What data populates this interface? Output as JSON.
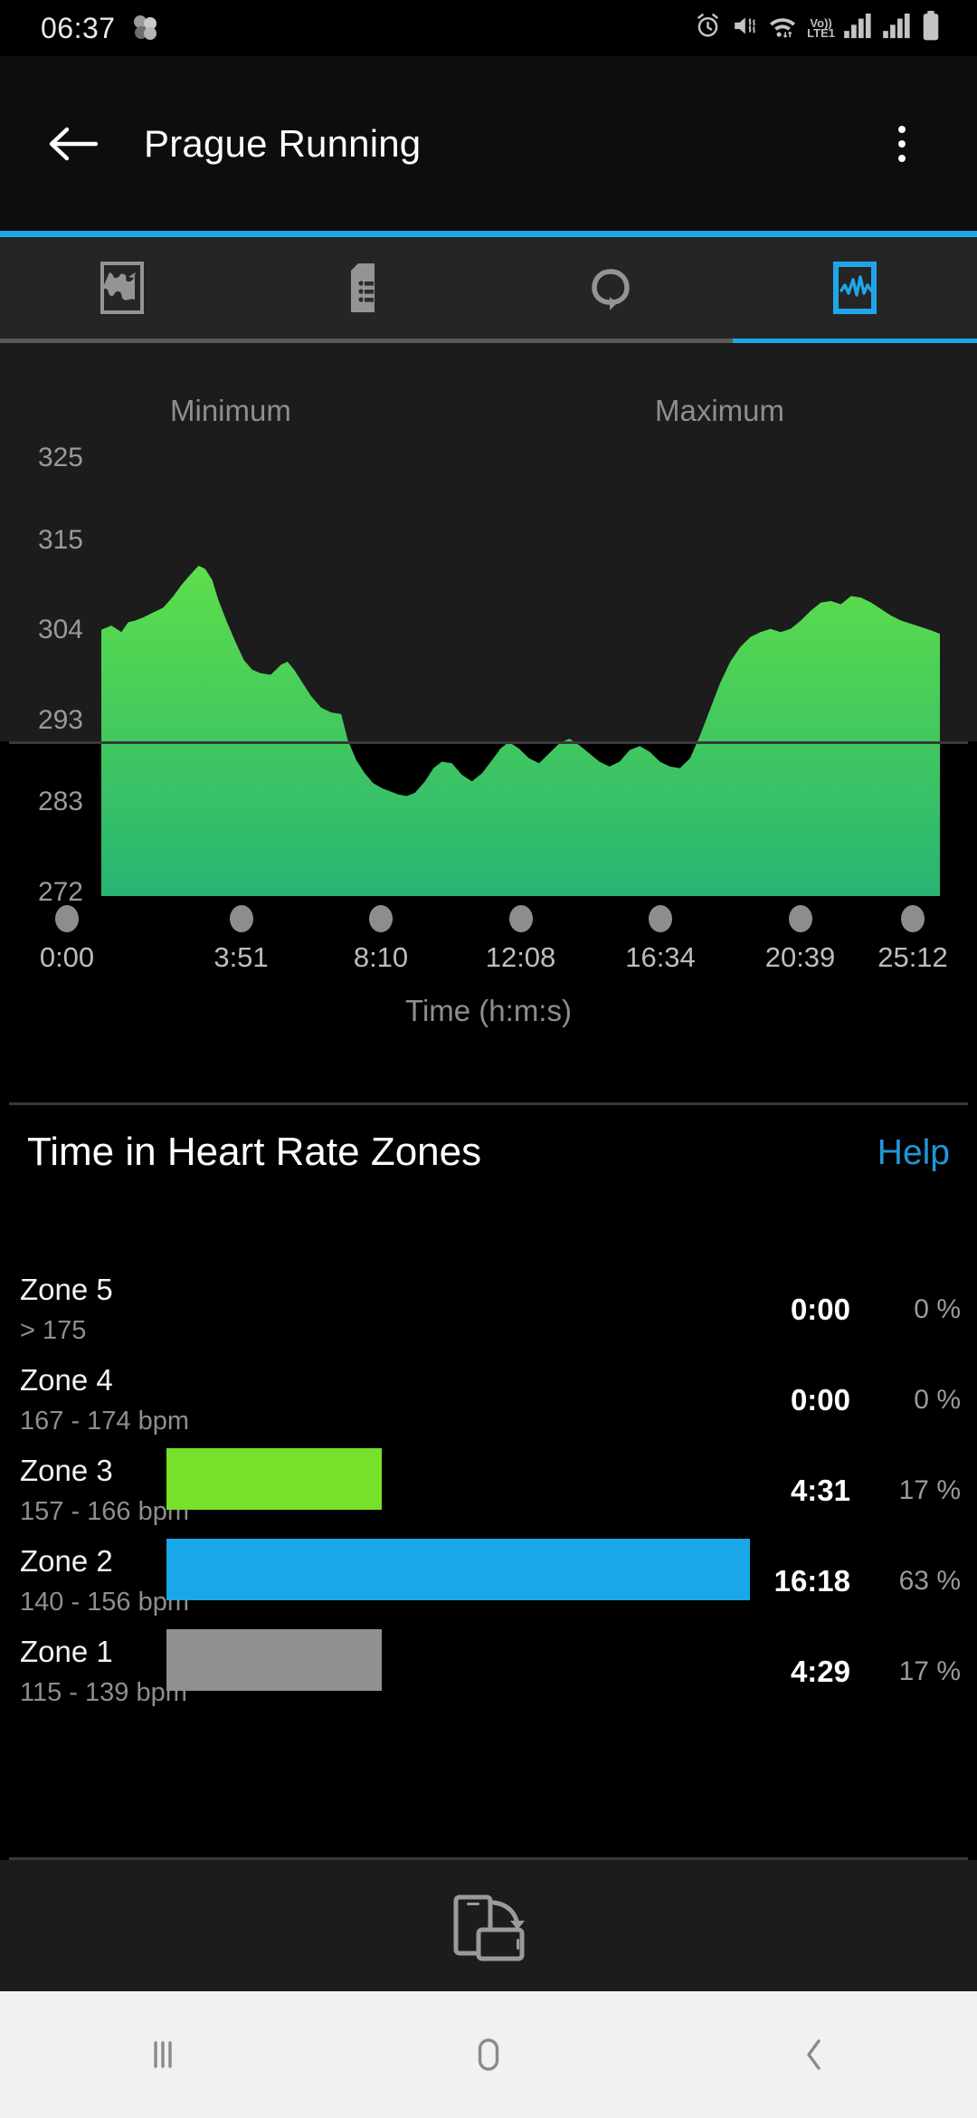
{
  "status_bar": {
    "time": "06:37",
    "left_icons": [
      "app-cluster-icon"
    ],
    "right_icons": [
      "alarm-icon",
      "vibrate-mute-icon",
      "wifi-icon"
    ],
    "network_label_top": "Vo))",
    "network_label_bottom": "LTE1"
  },
  "app_bar": {
    "title": "Prague Running",
    "back_icon": "back-arrow-icon",
    "overflow_icon": "overflow-menu-icon"
  },
  "tabs": [
    {
      "name": "map",
      "icon": "map-route-icon",
      "selected": false
    },
    {
      "name": "details",
      "icon": "document-list-icon",
      "selected": false
    },
    {
      "name": "laps",
      "icon": "loop-repeat-icon",
      "selected": false
    },
    {
      "name": "graphs",
      "icon": "graph-chart-icon",
      "selected": true
    }
  ],
  "chart_header": {
    "minimum_label": "Minimum",
    "maximum_label": "Maximum"
  },
  "chart_data": {
    "type": "area",
    "title": "",
    "xlabel": "Time (h:m:s)",
    "ylabel": "",
    "ytick_labels": [
      "325",
      "315",
      "304",
      "293",
      "283",
      "272"
    ],
    "ytick_values": [
      325,
      315,
      304,
      293,
      283,
      272
    ],
    "ylim": [
      272,
      325
    ],
    "xtick_labels": [
      "0:00",
      "3:51",
      "8:10",
      "12:08",
      "16:34",
      "20:39",
      "25:12"
    ],
    "grid": false,
    "legend": "none",
    "fill_top_color": "#5ede4a",
    "fill_bottom_color": "#27b473",
    "x": [
      0.0,
      1.2,
      2.4,
      3.2,
      4.0,
      5.0,
      6.2,
      7.4,
      8.6,
      9.6,
      10.6,
      11.6,
      12.4,
      13.2,
      14.0,
      15.0,
      16.0,
      17.0,
      18.0,
      19.0,
      20.2,
      21.4,
      22.2,
      23.0,
      24.0,
      25.0,
      26.2,
      27.4,
      28.6,
      29.4,
      30.4,
      31.4,
      32.4,
      33.4,
      34.4,
      35.4,
      36.4,
      37.4,
      38.6,
      39.6,
      40.6,
      41.8,
      43.0,
      44.2,
      45.4,
      46.6,
      47.6,
      48.6,
      49.8,
      51.0,
      52.2,
      53.4,
      54.6,
      55.8,
      57.0,
      58.2,
      59.4,
      60.6,
      61.8,
      63.0,
      64.2,
      65.4,
      66.6,
      67.8,
      69.0,
      70.2,
      71.4,
      72.6,
      73.8,
      75.0,
      76.2,
      77.4,
      78.6,
      79.8,
      81.0,
      82.2,
      83.4,
      84.6,
      85.8,
      87.0,
      88.2,
      89.4,
      90.6,
      91.8,
      93.0,
      94.2,
      95.4,
      96.6,
      97.8,
      99.0,
      100.0
    ],
    "values": [
      304.5,
      305.0,
      304.2,
      305.4,
      305.6,
      306.0,
      306.6,
      307.2,
      308.6,
      310.0,
      311.2,
      312.3,
      311.9,
      310.6,
      308.0,
      305.4,
      303.0,
      300.8,
      299.6,
      299.2,
      299.0,
      300.2,
      300.6,
      299.6,
      298.0,
      296.4,
      295.0,
      294.4,
      294.2,
      291.0,
      288.6,
      287.0,
      285.8,
      285.2,
      284.8,
      284.4,
      284.2,
      284.6,
      286.0,
      287.6,
      288.4,
      288.2,
      286.8,
      286.0,
      287.0,
      288.6,
      290.0,
      290.8,
      290.0,
      288.8,
      288.2,
      289.4,
      290.6,
      291.2,
      290.4,
      289.4,
      288.4,
      287.8,
      288.4,
      289.8,
      290.3,
      289.6,
      288.4,
      287.8,
      287.6,
      288.8,
      291.6,
      294.8,
      298.0,
      300.6,
      302.4,
      303.6,
      304.2,
      304.6,
      304.2,
      304.6,
      305.6,
      306.8,
      307.8,
      308.0,
      307.6,
      308.6,
      308.4,
      307.8,
      307.0,
      306.2,
      305.6,
      305.2,
      304.8,
      304.4,
      304.0
    ]
  },
  "zones_section": {
    "title": "Time in Heart Rate Zones",
    "help_label": "Help",
    "max_bar_percent": 63,
    "rows": [
      {
        "name": "Zone 5",
        "range": "> 175",
        "time": "0:00",
        "percent": "0 %",
        "bar_percent": 0,
        "color": "#e83b3b"
      },
      {
        "name": "Zone 4",
        "range": "167 - 174 bpm",
        "time": "0:00",
        "percent": "0 %",
        "bar_percent": 0,
        "color": "#f0a030"
      },
      {
        "name": "Zone 3",
        "range": "157 - 166 bpm",
        "time": "4:31",
        "percent": "17 %",
        "bar_percent": 17,
        "color": "#76e02a"
      },
      {
        "name": "Zone 2",
        "range": "140 - 156 bpm",
        "time": "16:18",
        "percent": "63 %",
        "bar_percent": 63,
        "color": "#1aa7e8"
      },
      {
        "name": "Zone 1",
        "range": "115 - 139 bpm",
        "time": "4:29",
        "percent": "17 %",
        "bar_percent": 17,
        "color": "#909090"
      }
    ]
  },
  "rotate_bar": {
    "icon": "rotate-screen-icon"
  },
  "nav_bar": {
    "recents_icon": "recents-icon",
    "home_icon": "home-icon",
    "back_icon": "nav-back-icon"
  }
}
